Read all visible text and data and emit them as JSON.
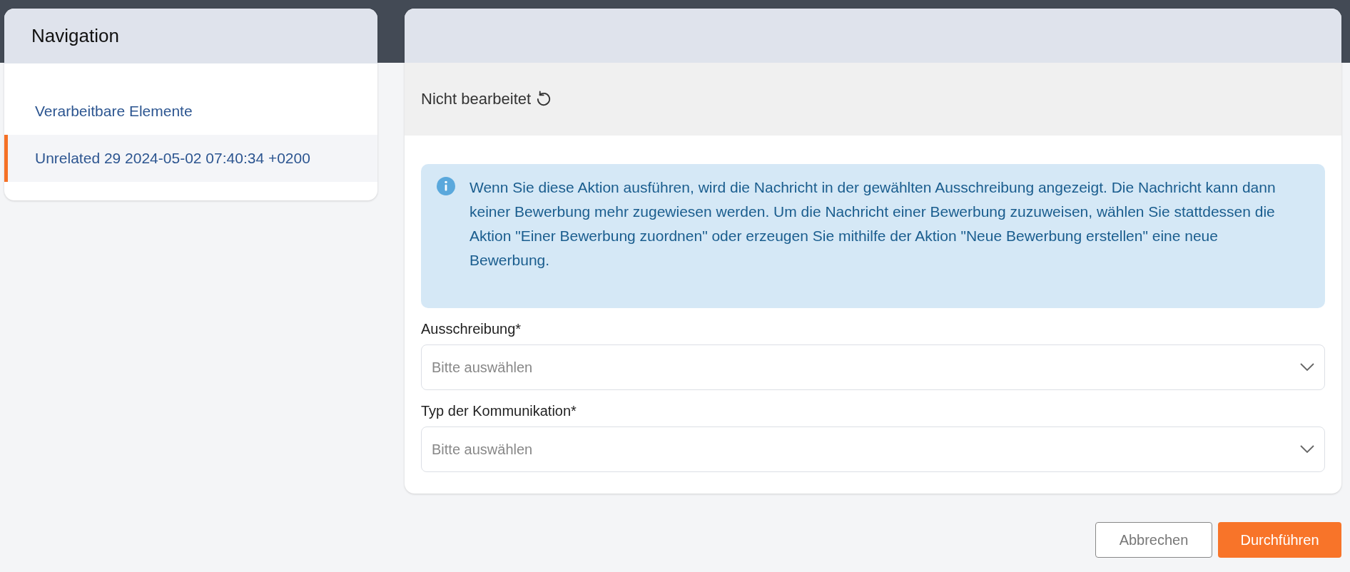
{
  "navigation": {
    "title": "Navigation",
    "items": [
      {
        "label": "Verarbeitbare Elemente",
        "selected": false
      },
      {
        "label": "Unrelated 29 2024-05-02 07:40:34 +0200",
        "selected": true
      }
    ]
  },
  "panel": {
    "status": "Nicht bearbeitet",
    "info": "Wenn Sie diese Aktion ausführen, wird die Nachricht in der gewählten Ausschreibung angezeigt. Die Nachricht kann dann keiner Bewerbung mehr zugewiesen werden. Um die Nachricht einer Bewerbung zuzuweisen, wählen Sie stattdessen die Aktion \"Einer Bewerbung zuordnen\" oder erzeugen Sie mithilfe der Aktion \"Neue Bewerbung erstellen\" eine neue Bewerbung.",
    "fields": [
      {
        "label": "Ausschreibung*",
        "placeholder": "Bitte auswählen"
      },
      {
        "label": "Typ der Kommunikation*",
        "placeholder": "Bitte auswählen"
      }
    ]
  },
  "buttons": [
    {
      "label": "Abbrechen",
      "kind": "secondary"
    },
    {
      "label": "Durchführen",
      "kind": "primary"
    }
  ]
}
